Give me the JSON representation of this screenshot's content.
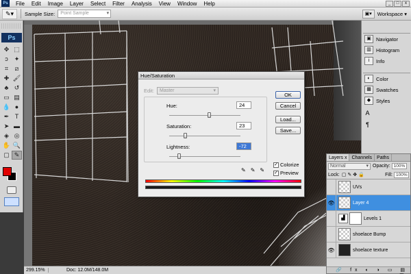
{
  "menu": {
    "ps_mini": "Ps",
    "items": [
      "File",
      "Edit",
      "Image",
      "Layer",
      "Select",
      "Filter",
      "Analysis",
      "View",
      "Window",
      "Help"
    ],
    "window_buttons": [
      "_",
      "□",
      "x"
    ]
  },
  "options": {
    "tool_icon": "eyedropper-icon",
    "sample_size_label": "Sample Size:",
    "sample_size_value": "Point Sample",
    "workspace_label": "Workspace"
  },
  "toolbox": {
    "logo": "Ps"
  },
  "dock": {
    "group1": [
      "Navigator",
      "Histogram",
      "Info"
    ],
    "group2": [
      "Color",
      "Swatches",
      "Styles"
    ]
  },
  "status": {
    "zoom": "299.15%",
    "doc": "Doc: 12.0M/148.0M"
  },
  "dialog": {
    "title": "Hue/Saturation",
    "edit_label": "Edit:",
    "edit_value": "Master",
    "hue": {
      "label": "Hue:",
      "value": "24",
      "range": [
        -180,
        180
      ]
    },
    "saturation": {
      "label": "Saturation:",
      "value": "23",
      "range": [
        0,
        100
      ]
    },
    "lightness": {
      "label": "Lightness:",
      "value": "-72",
      "range": [
        -100,
        100
      ]
    },
    "buttons": {
      "ok": "OK",
      "cancel": "Cancel",
      "load": "Load...",
      "save": "Save..."
    },
    "colorize": {
      "label": "Colorize",
      "checked": true
    },
    "preview": {
      "label": "Preview",
      "checked": true
    }
  },
  "layers": {
    "tabs": [
      "Layers x",
      "Channels",
      "Paths"
    ],
    "blend_mode": "Normal",
    "opacity_label": "Opacity:",
    "opacity_value": "100%",
    "lock_label": "Lock:",
    "fill_label": "Fill:",
    "fill_value": "100%",
    "items": [
      {
        "name": "UVs",
        "visible": false,
        "selected": false
      },
      {
        "name": "Layer 4",
        "visible": true,
        "selected": true
      },
      {
        "name": "Levels 1",
        "visible": false,
        "selected": false
      },
      {
        "name": "shoelace Bump",
        "visible": false,
        "selected": false
      },
      {
        "name": "shoelace texture",
        "visible": true,
        "selected": false
      }
    ]
  }
}
